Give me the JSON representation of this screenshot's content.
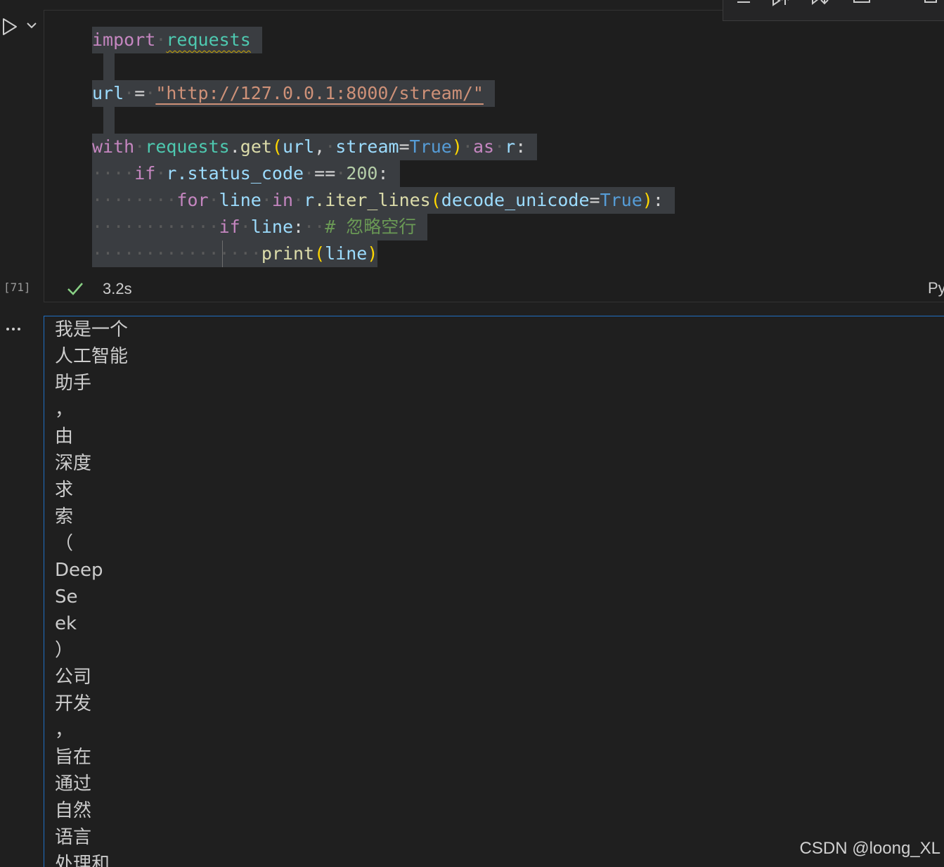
{
  "gutter": {
    "execution_count": "[71]"
  },
  "code_cell": {
    "line1": {
      "kw": "import",
      "module": "requests"
    },
    "line3": {
      "var": "url",
      "op": "=",
      "str": "\"http://127.0.0.1:8000/stream/\""
    },
    "line5": {
      "kw": "with",
      "module": "requests",
      "dot": ".",
      "fn": "get",
      "open": "(",
      "arg1": "url",
      "comma": ",",
      "kwarg": "stream",
      "eq": "=",
      "const": "True",
      "close": ")",
      "as": "as",
      "alias": "r",
      "colon": ":"
    },
    "line6": {
      "kw": "if",
      "obj": "r",
      "attr": ".status_code",
      "op": "==",
      "num": "200",
      "colon": ":"
    },
    "line7": {
      "kw": "for",
      "var": "line",
      "in": "in",
      "obj": "r",
      "method": ".iter_lines",
      "open": "(",
      "kwarg": "decode_unicode",
      "eq": "=",
      "const": "True",
      "close": ")",
      "colon": ":"
    },
    "line8": {
      "kw": "if",
      "var": "line",
      "colon": ":",
      "comment": "# 忽略空行"
    },
    "line9": {
      "fn": "print",
      "open": "(",
      "arg": "line",
      "close": ")"
    }
  },
  "status": {
    "duration": "3.2s",
    "kernel": "Py"
  },
  "output_lines": [
    "我是一个",
    "人工智能",
    "助手",
    "，",
    "由",
    "深度",
    "求",
    "索",
    "（",
    "Deep",
    "Se",
    "ek",
    "）",
    "公司",
    "开发",
    "，",
    "旨在",
    "通过",
    "自然",
    "语言",
    "处理和"
  ],
  "watermark": "CSDN @loong_XL",
  "colors": {
    "success": "#89d185",
    "output_border": "#1e6fc2",
    "keyword": "#c586c0",
    "string": "#ce9178"
  }
}
